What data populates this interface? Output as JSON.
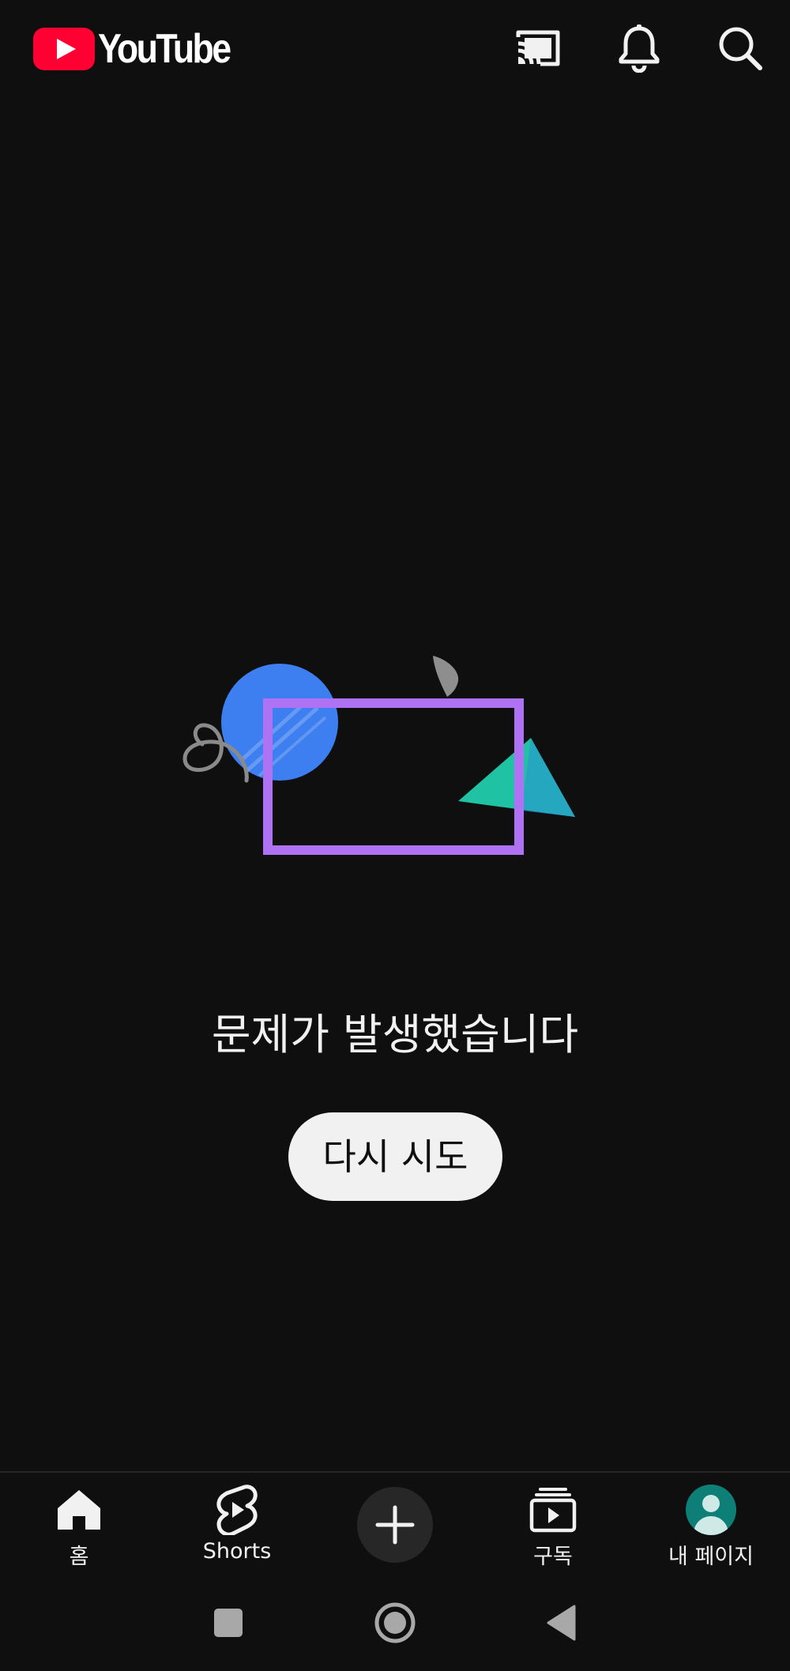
{
  "app": {
    "logo_text": "YouTube",
    "brand_red": "#ff0033",
    "background": "#0f0f0f"
  },
  "header": {
    "icons": [
      "cast-icon",
      "notifications-bell-icon",
      "search-icon"
    ]
  },
  "illustration": {
    "colors": {
      "circle": "#3d7ff0",
      "frame": "#b072f5",
      "triangle": "#1fc3a3",
      "squiggle": "#8a8a8a",
      "leaf": "#8e8e8e"
    }
  },
  "error": {
    "message": "문제가 발생했습니다",
    "retry_label": "다시 시도"
  },
  "bottom_nav": {
    "items": [
      {
        "label": "홈",
        "icon": "home-icon",
        "active": true
      },
      {
        "label": "Shorts",
        "icon": "shorts-icon"
      },
      {
        "label": "",
        "icon": "create-plus-icon"
      },
      {
        "label": "구독",
        "icon": "subscriptions-icon"
      },
      {
        "label": "내 페이지",
        "icon": "avatar"
      }
    ]
  },
  "system_nav": {
    "icons": [
      "recents-icon",
      "home-circle-icon",
      "back-triangle-icon"
    ]
  }
}
